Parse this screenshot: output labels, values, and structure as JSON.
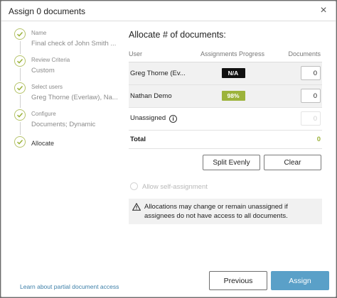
{
  "dialog": {
    "title": "Assign 0 documents",
    "close_glyph": "×"
  },
  "steps": [
    {
      "label": "Name",
      "value": "Final check of John Smith ..."
    },
    {
      "label": "Review Criteria",
      "value": "Custom"
    },
    {
      "label": "Select users",
      "value": "Greg Thorne (Everlaw), Na..."
    },
    {
      "label": "Configure",
      "value": "Documents; Dynamic"
    },
    {
      "label": "Allocate",
      "value": ""
    }
  ],
  "learn_link": "Learn about partial document access",
  "main": {
    "heading": "Allocate # of documents:",
    "columns": [
      "User",
      "Assignments Progress",
      "Documents"
    ],
    "rows": [
      {
        "user": "Greg Thorne (Ev...",
        "progress": "N/A",
        "documents": "0"
      },
      {
        "user": "Nathan Demo",
        "progress": "98%",
        "documents": "0"
      },
      {
        "user": "Unassigned",
        "documents": "0"
      }
    ],
    "total_label": "Total",
    "total_value": "0",
    "split_label": "Split Evenly",
    "clear_label": "Clear",
    "self_assign_label": "Allow self-assignment",
    "warning_text": "Allocations may change or remain unassigned if assignees do not have access to all documents."
  },
  "footer": {
    "previous_label": "Previous",
    "assign_label": "Assign"
  },
  "colors": {
    "accent_green": "#9cb33b",
    "primary_blue": "#5aa0c8",
    "link_blue": "#3d7fa8"
  }
}
